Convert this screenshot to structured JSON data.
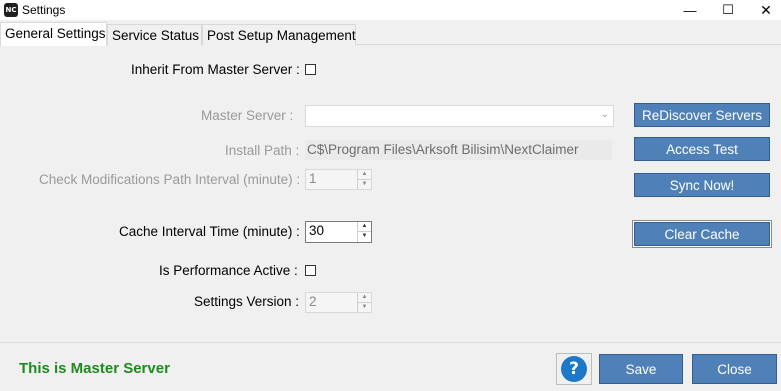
{
  "window": {
    "title": "Settings",
    "icon_text": "NC",
    "minimize_glyph": "—",
    "maximize_glyph": "☐",
    "close_glyph": "✕"
  },
  "tabs": [
    {
      "label": "General Settings",
      "active": true
    },
    {
      "label": "Service Status",
      "active": false
    },
    {
      "label": "Post Setup Management",
      "active": false
    }
  ],
  "form": {
    "inherit_label": "Inherit From Master Server :",
    "inherit_checked": false,
    "master_server_label": "Master Server  :",
    "master_server_value": "",
    "install_path_label": "Install Path  :",
    "install_path_value": "C$\\Program Files\\Arksoft Bilisim\\NextClaimer",
    "check_interval_label": "Check Modifications Path Interval (minute)  :",
    "check_interval_value": "1",
    "cache_interval_label": "Cache Interval Time (minute)  :",
    "cache_interval_value": "30",
    "performance_label": "Is Performance Active :",
    "performance_checked": false,
    "settings_version_label": "Settings Version :",
    "settings_version_value": "2"
  },
  "buttons": {
    "rediscover": "ReDiscover Servers",
    "access_test": "Access Test",
    "sync_now": "Sync Now!",
    "clear_cache": "Clear Cache",
    "save": "Save",
    "close": "Close",
    "help": "?"
  },
  "footer": {
    "status_text": "This is Master Server"
  },
  "colors": {
    "button_blue": "#4f81b8",
    "status_green": "#1f8a1f",
    "help_blue": "#1e78c8"
  }
}
